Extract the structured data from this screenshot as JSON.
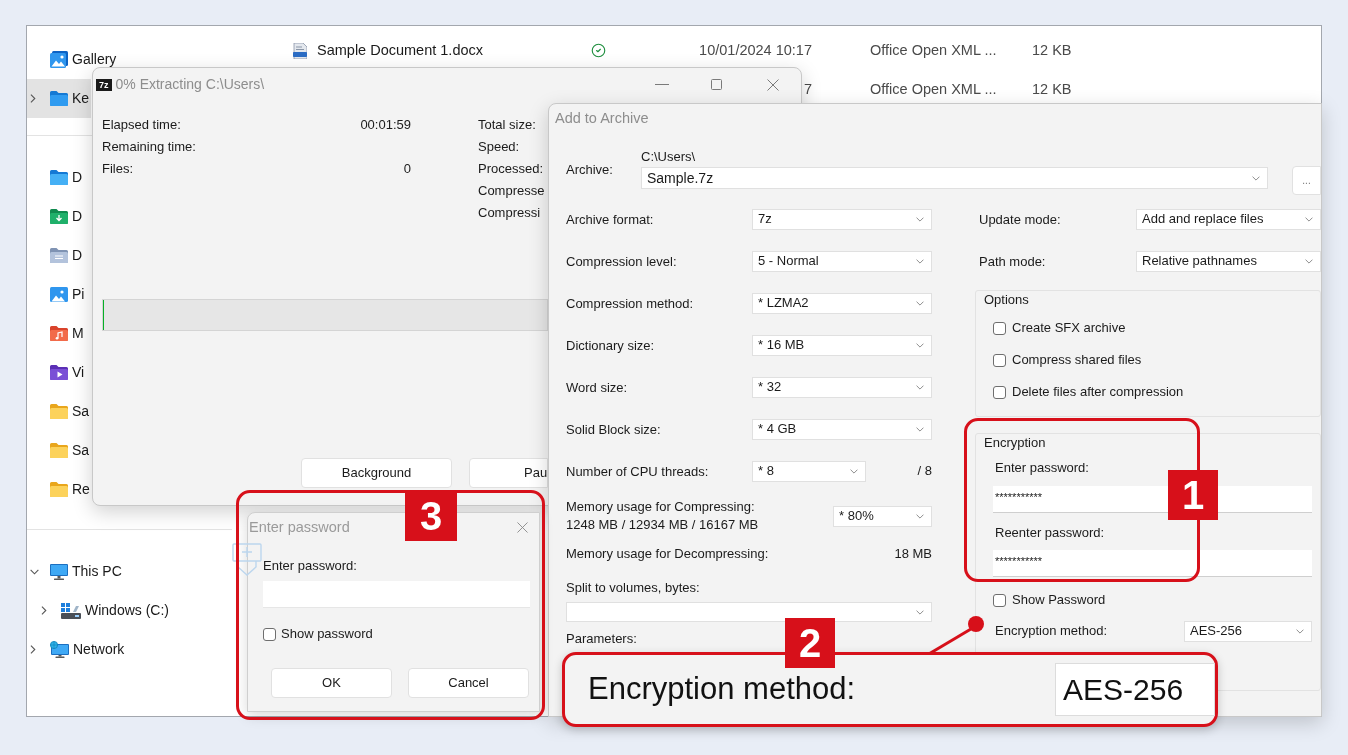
{
  "explorer": {
    "sidebar": {
      "pinned": [
        {
          "label": "Gallery",
          "selected": false,
          "expandable": false
        },
        {
          "label": "Ke",
          "selected": true,
          "expandable": true
        }
      ],
      "folders": [
        {
          "label": "D",
          "selected": false
        },
        {
          "label": "D",
          "selected": false
        },
        {
          "label": "D",
          "selected": false
        },
        {
          "label": "Pi",
          "selected": false
        },
        {
          "label": "M",
          "selected": false
        },
        {
          "label": "Vi",
          "selected": false
        },
        {
          "label": "Sa",
          "selected": false
        },
        {
          "label": "Sa",
          "selected": false
        },
        {
          "label": "Re",
          "selected": false
        }
      ],
      "tree": [
        {
          "label": "This PC",
          "expanded": true,
          "children": [
            {
              "label": "Windows (C:)",
              "expanded": false
            }
          ]
        },
        {
          "label": "Network",
          "expanded": false
        }
      ]
    },
    "files": [
      {
        "name": "Sample Document 1.docx",
        "synced": true,
        "date": "10/01/2024 10:17",
        "type": "Office Open XML ...",
        "size": "12 KB"
      },
      {
        "date": "7",
        "type": "Office Open XML ...",
        "size": "12 KB"
      }
    ]
  },
  "extract_window": {
    "logo": "7z",
    "title": "0% Extracting C:\\Users\\",
    "stats": [
      {
        "label": "Elapsed time:",
        "value": "00:01:59"
      },
      {
        "label": "Remaining time:"
      },
      {
        "label": "Files:",
        "value": "0"
      }
    ],
    "totals": [
      {
        "label": "Total size:"
      },
      {
        "label": "Speed:"
      },
      {
        "label": "Processed:"
      },
      {
        "label": "Compresse"
      },
      {
        "label": "Compressi"
      }
    ],
    "progress": {
      "level": 0
    },
    "buttons": [
      "Background",
      "Pau"
    ]
  },
  "archive_window": {
    "title": "Add to Archive",
    "archive": {
      "label": "Archive:",
      "folder": "C:\\Users\\",
      "value": "Sample.7z",
      "browse": "..."
    },
    "settings": [
      {
        "kind": "select",
        "label": "Archive format:",
        "value": "7z"
      },
      {
        "kind": "select",
        "label": "Compression level:",
        "value": "5 - Normal"
      },
      {
        "kind": "select",
        "label": "Compression method:",
        "value": "* LZMA2"
      },
      {
        "kind": "select",
        "label": "Dictionary size:",
        "value": "* 16 MB"
      },
      {
        "kind": "select",
        "label": "Word size:",
        "value": "* 32"
      },
      {
        "kind": "select",
        "label": "Solid Block size:",
        "value": "* 4 GB"
      },
      {
        "kind": "select_short",
        "label": "Number of CPU threads:",
        "value": "* 8",
        "suffix": "/ 8"
      },
      {
        "kind": "memory",
        "label": "Memory usage for Compressing:",
        "detail": "1248 MB / 12934 MB / 16167 MB",
        "value": "* 80%"
      },
      {
        "kind": "reading",
        "label": "Memory usage for Decompressing:",
        "value": "18 MB"
      },
      {
        "kind": "wide_select",
        "label": "Split to volumes, bytes:"
      },
      {
        "kind": "label",
        "label": "Parameters:"
      }
    ],
    "update_mode": {
      "label": "Update mode:",
      "value": "Add and replace files"
    },
    "path_mode": {
      "label": "Path mode:",
      "value": "Relative pathnames"
    },
    "options": {
      "title": "Options",
      "items": [
        {
          "label": "Create SFX archive",
          "checked": false
        },
        {
          "label": "Compress shared files",
          "checked": false
        },
        {
          "label": "Delete files after compression",
          "checked": false
        }
      ]
    },
    "encryption": {
      "title": "Encryption",
      "fields": [
        {
          "label": "Enter password:",
          "value": "***********"
        },
        {
          "label": "Reenter password:",
          "value": "***********"
        }
      ],
      "show_password": {
        "label": "Show Password",
        "checked": false
      },
      "method": {
        "label": "Encryption method:",
        "value": "AES-256"
      }
    }
  },
  "password_dialog": {
    "title": "Enter password",
    "label": "Enter password:",
    "show_password": {
      "label": "Show password",
      "checked": false
    },
    "buttons": [
      "OK",
      "Cancel"
    ]
  },
  "callouts": [
    {
      "number": "1"
    },
    {
      "number": "2",
      "label": "Encryption method:",
      "value": "AES-256"
    },
    {
      "number": "3"
    }
  ]
}
